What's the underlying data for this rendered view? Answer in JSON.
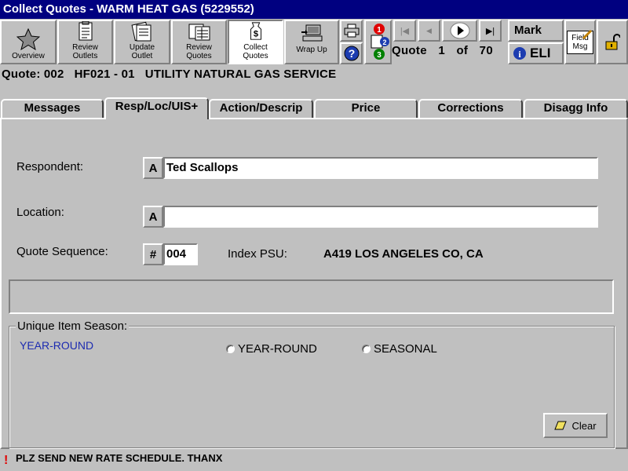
{
  "window": {
    "title": "Collect Quotes -  WARM HEAT GAS (5229552)"
  },
  "toolbar": {
    "overview": "Overview",
    "review_outlets": "Review\nOutlets",
    "update_outlet": "Update\nOutlet",
    "review_quotes": "Review\nQuotes",
    "collect_quotes": "Collect\nQuotes",
    "wrap_up": "Wrap Up",
    "field_msg": "Field\nMsg",
    "user": "Mark",
    "eli": "ELI",
    "badges": [
      "1",
      "2",
      "3"
    ],
    "quote_label": "Quote",
    "quote_current": "1",
    "quote_of": "of",
    "quote_total": "70"
  },
  "quote_header": {
    "quote_no": "Quote: 002",
    "item_code": "HF021 - 01",
    "description": "UTILITY NATURAL GAS SERVICE"
  },
  "tabs": [
    {
      "label": "Messages",
      "active": false
    },
    {
      "label": "Resp/Loc/UIS+",
      "active": true
    },
    {
      "label": "Action/Descrip",
      "active": false
    },
    {
      "label": "Price",
      "active": false
    },
    {
      "label": "Corrections",
      "active": false
    },
    {
      "label": "Disagg Info",
      "active": false
    }
  ],
  "form": {
    "respondent_label": "Respondent:",
    "respondent_value": "Ted Scallops",
    "location_label": "Location:",
    "location_value": "",
    "sequence_label": "Quote Sequence:",
    "sequence_value": "004",
    "a_button": "A",
    "hash_button": "#",
    "index_psu_label": "Index PSU:",
    "index_psu_value": "A419 LOS ANGELES CO, CA"
  },
  "season": {
    "group_label": "Unique Item Season:",
    "current_value": "YEAR-ROUND",
    "options": [
      "YEAR-ROUND",
      "SEASONAL"
    ],
    "clear_label": "Clear"
  },
  "status": {
    "message": "PLZ SEND NEW RATE SCHEDULE. THANX",
    "indicator": "!"
  },
  "colors": {
    "title_bar": "#000080",
    "season_value_text": "#1c2bb0",
    "status_indicator": "#e00000"
  }
}
